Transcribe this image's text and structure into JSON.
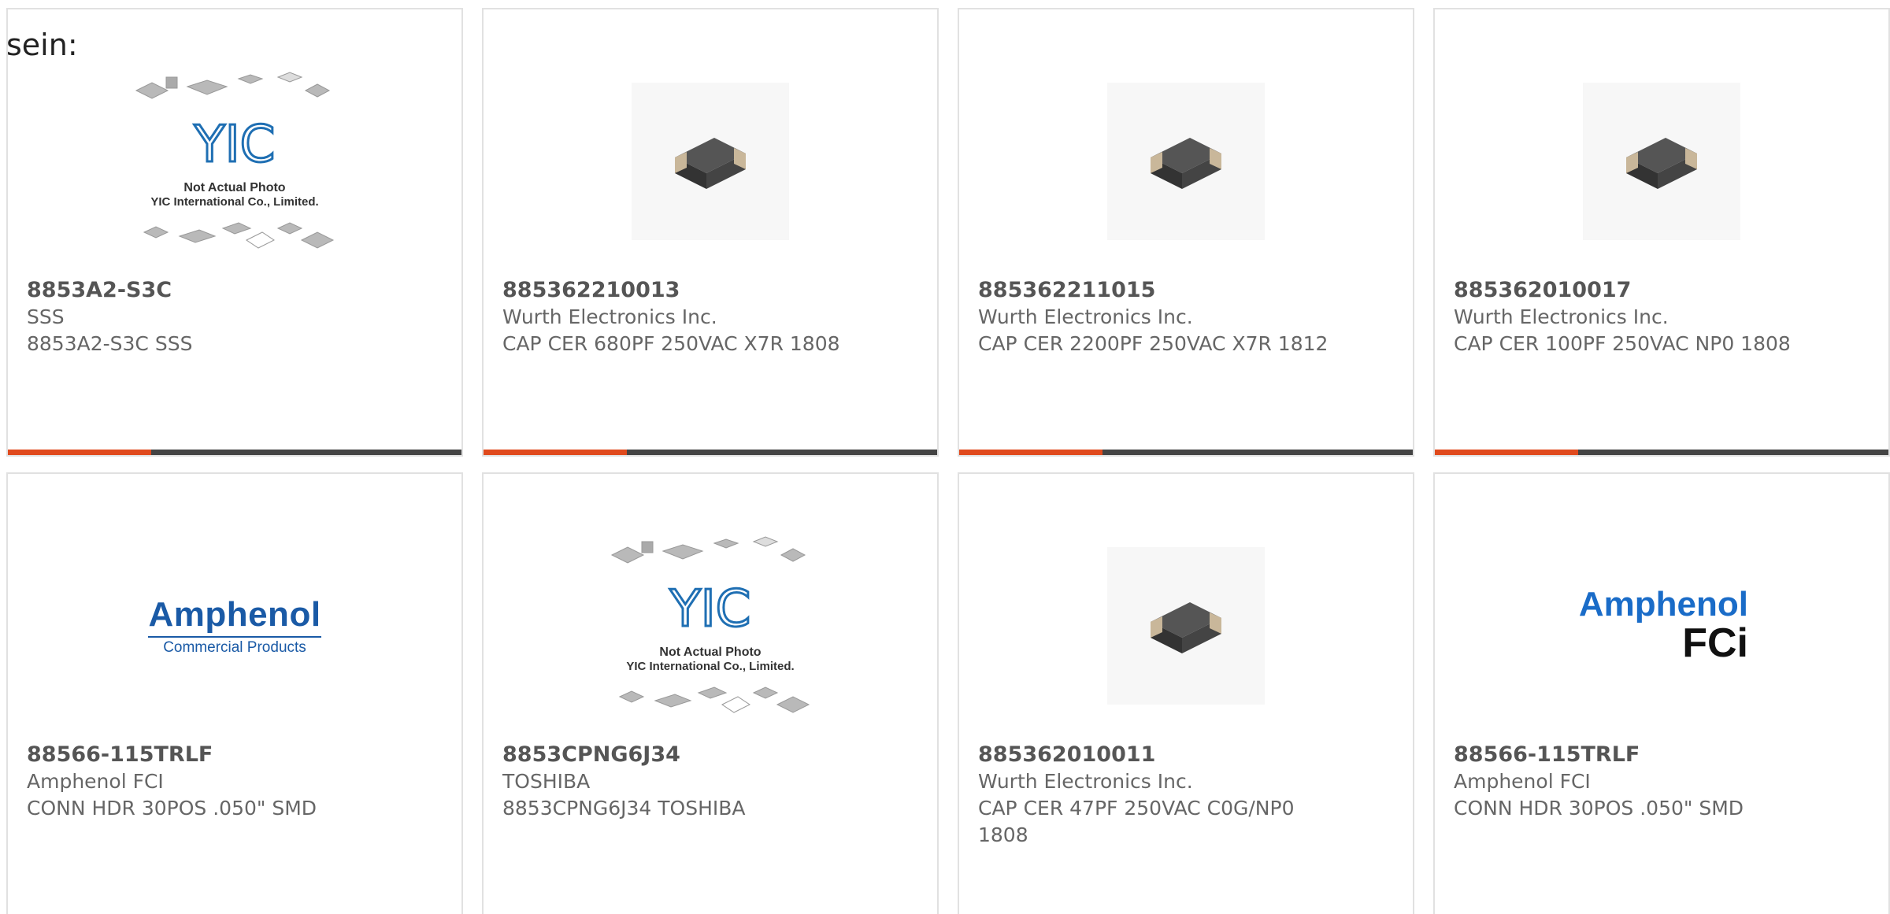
{
  "intro_text": "sein:",
  "cards": [
    {
      "part_number": "8853A2-S3C",
      "manufacturer": "SSS",
      "description": "8853A2-S3C SSS",
      "image": "placeholder-photo",
      "image_text_1": "Not Actual Photo",
      "image_text_2": "YIC International Co., Limited.",
      "image_logo": "YIC"
    },
    {
      "part_number": "885362210013",
      "manufacturer": "Wurth Electronics Inc.",
      "description": "CAP CER 680PF 250VAC X7R 1808",
      "image": "ceramic-capacitor-photo"
    },
    {
      "part_number": "885362211015",
      "manufacturer": "Wurth Electronics Inc.",
      "description": "CAP CER 2200PF 250VAC X7R 1812",
      "image": "ceramic-capacitor-photo"
    },
    {
      "part_number": "885362010017",
      "manufacturer": "Wurth Electronics Inc.",
      "description": "CAP CER 100PF 250VAC NP0 1808",
      "image": "ceramic-capacitor-photo"
    },
    {
      "part_number": "88566-115TRLF",
      "manufacturer": "Amphenol FCI",
      "description": "CONN HDR 30POS .050\" SMD",
      "image": "amphenol-commercial-logo",
      "logo_main": "Amphenol",
      "logo_sub": "Commercial Products"
    },
    {
      "part_number": "8853CPNG6J34",
      "manufacturer": "TOSHIBA",
      "description": "8853CPNG6J34 TOSHIBA",
      "image": "placeholder-photo",
      "image_text_1": "Not Actual Photo",
      "image_text_2": "YIC International Co., Limited.",
      "image_logo": "YIC"
    },
    {
      "part_number": "885362010011",
      "manufacturer": "Wurth Electronics Inc.",
      "description": "CAP CER 47PF 250VAC C0G/NP0 1808",
      "image": "ceramic-capacitor-photo"
    },
    {
      "part_number": "88566-115TRLF",
      "manufacturer": "Amphenol FCI",
      "description": "CONN HDR 30POS .050\" SMD",
      "image": "amphenol-fci-logo",
      "logo_main": "Amphenol",
      "logo_sub": "FCi"
    }
  ],
  "colors": {
    "accent": "#e04a1d",
    "bar": "#444444",
    "border": "#e1e1e1",
    "text": "#666666",
    "logo_blue": "#1a5aa6"
  }
}
